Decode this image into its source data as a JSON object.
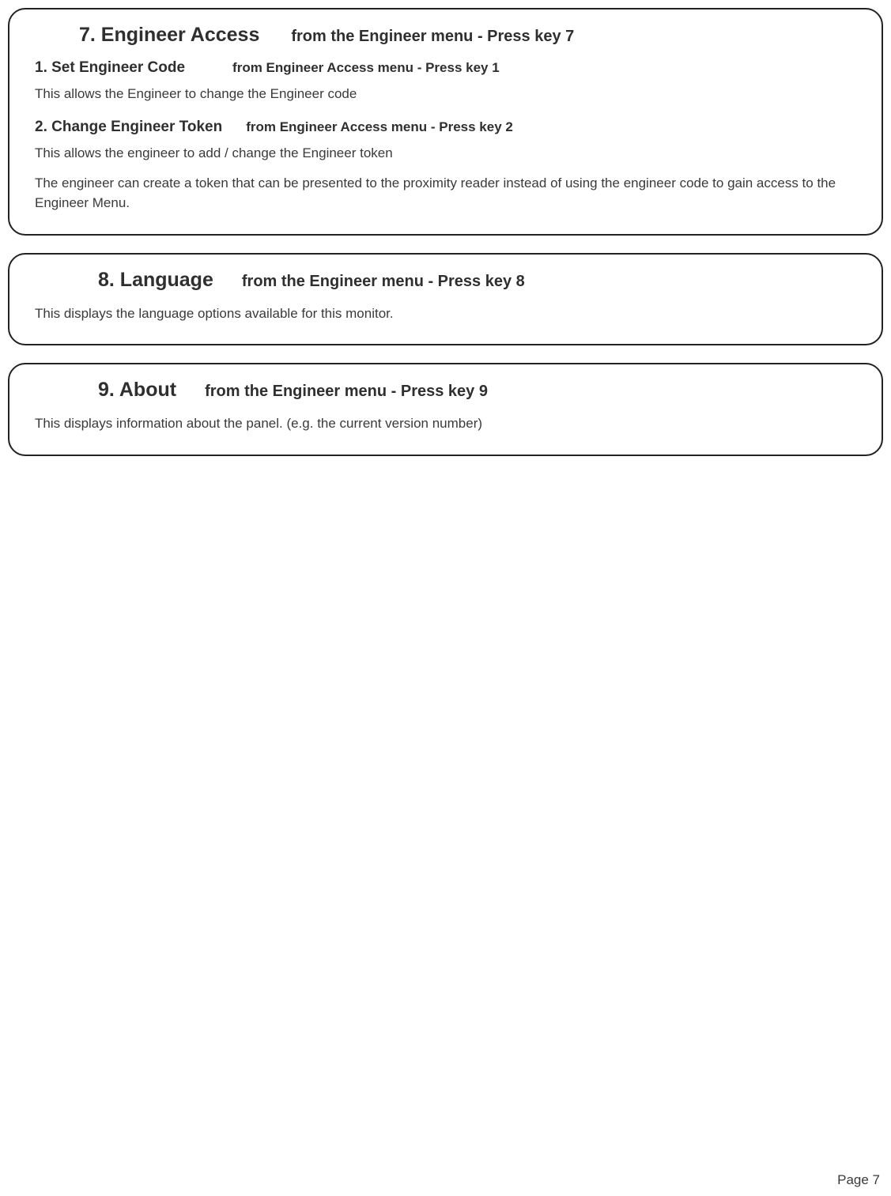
{
  "section7": {
    "title": "7. Engineer Access",
    "instruction": "from the Engineer menu - Press key 7",
    "sub1": {
      "title": "1. Set Engineer Code",
      "instruction": "from Engineer Access menu - Press key 1",
      "body": "This allows the Engineer to change the Engineer code"
    },
    "sub2": {
      "title": "2. Change Engineer Token",
      "instruction": "from Engineer Access menu - Press key 2",
      "body1": "This allows the engineer to add / change the Engineer token",
      "body2": "The engineer can create a token that can be presented to the proximity reader instead of using the engineer code to gain access to the Engineer Menu."
    }
  },
  "section8": {
    "title": "8. Language",
    "instruction": "from the Engineer menu - Press key 8",
    "body": "This displays the language options available for this monitor."
  },
  "section9": {
    "title": "9. About",
    "instruction": "from the Engineer menu - Press key 9",
    "body": "This displays information about the panel. (e.g. the current version number)"
  },
  "page_number": "Page 7"
}
